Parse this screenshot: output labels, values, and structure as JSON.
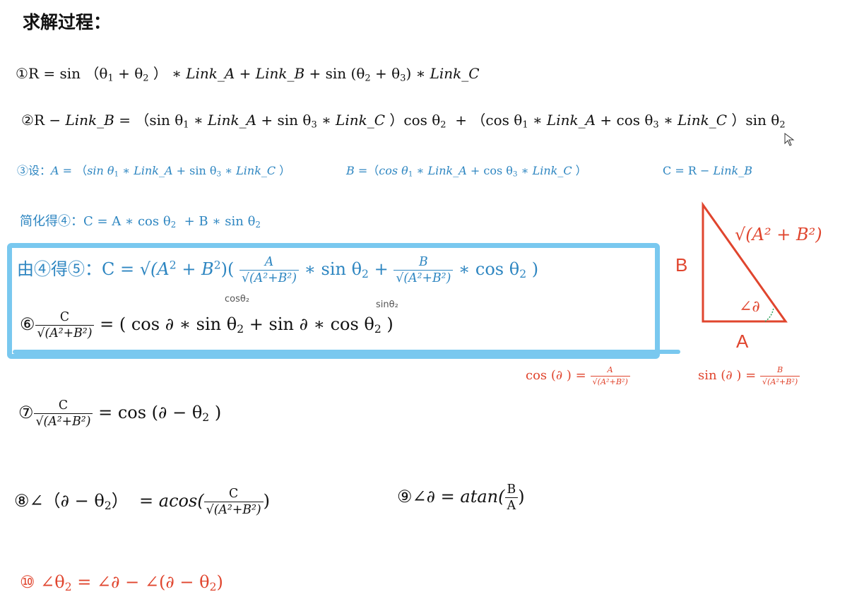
{
  "title": "求解过程：",
  "colors": {
    "blue": "#2e86c1",
    "red": "#e0452e",
    "highlight": "#79c8ef",
    "text": "#111111"
  },
  "eq1": {
    "marker": "①",
    "r": "R",
    "eq": "=",
    "sin": "sin",
    "lp": "（θ",
    "one": "1",
    "plus": "+ θ",
    "two": "2",
    "rp": "）",
    "mul": "∗",
    "linkA": "Link_A",
    "p1": "+",
    "linkB": "Link_B",
    "sin2": "+ sin (θ",
    "two2": "2",
    "plus2": "+ θ",
    "three": "3",
    "rp2": ")",
    "mul2": "∗",
    "linkC": "Link_C"
  },
  "eq2": {
    "marker": "②",
    "lhs": "R −",
    "linkB": "Link_B",
    "eq": "=",
    "p1": "（sin θ",
    "one": "1",
    "mul": "∗",
    "linkA": "Link_A",
    "sin3": "+ sin θ",
    "three": "3",
    "mul2": "∗",
    "linkC": "Link_C",
    "cos": "）cos θ",
    "two": "2",
    "plus": "+ （cos θ",
    "one2": "1",
    "mul3": "∗",
    "linkA2": "Link_A",
    "cos3": "+ cos θ",
    "three2": "3",
    "mul4": "∗",
    "linkC2": "Link_C",
    "sin": "）sin θ",
    "two2": "2"
  },
  "eq3": {
    "marker": "③设：",
    "a": "A",
    "eq": "=",
    "a_l": "（",
    "a_sin": "sin θ",
    "one": "1",
    "mul": "∗",
    "linkA": "Link_A",
    "a_sin3": "+ sin θ",
    "three": "3",
    "mul2": "∗",
    "linkC": "Link_C",
    "a_r": "）",
    "b": "B",
    "b_l": "=（",
    "b_cos": "cos θ",
    "one2": "1",
    "mul3": "∗",
    "linkA2": "Link_A",
    "b_cos3": "+ cos θ",
    "three2": "3",
    "mul4": "∗",
    "linkC2": "Link_C",
    "b_r": "）",
    "c": "C = R −",
    "linkB": "Link_B"
  },
  "eq4": {
    "prefix": "简化得④：C = A ∗ cos θ",
    "two": "2",
    "mid": "+ B ∗ sin θ",
    "two2": "2"
  },
  "eq5": {
    "prefix": "由④得⑤：C =",
    "sqrt": "√(A",
    "sq": "2",
    "plusb": "+ B",
    "sq2": "2",
    "rp": ")(",
    "fracA_num": "A",
    "fracA_den": "√(A²+B²)",
    "mul_sin": "∗ sin θ",
    "two": "2",
    "plus": "+",
    "fracB_num": "B",
    "fracB_den": "√(A²+B²)",
    "mul_cos": "∗ cos θ",
    "two2": "2",
    "end": ")"
  },
  "handnotes": {
    "cos": "cosθ₂",
    "sin": "sinθ₂"
  },
  "eq6": {
    "marker": "⑥",
    "num": "C",
    "den": "√(A²+B²)",
    "eq": "= (",
    "cos": "cos ∂ ∗ sin θ",
    "two": "2",
    "plus": "+",
    "sin": "sin ∂ ∗ cos θ",
    "two2": "2",
    "end": ")"
  },
  "eq7": {
    "marker": "⑦",
    "num": "C",
    "den": "√(A²+B²)",
    "rhs": "= cos (∂ − θ",
    "two": "2",
    "end": ")"
  },
  "eq8": {
    "marker": "⑧∠（∂ − θ",
    "two": "2",
    "mid": "）",
    "eq": "=",
    "acos": "acos(",
    "num": "C",
    "den": "√(A²+B²)",
    "end": ")"
  },
  "eq9": {
    "marker": "⑨∠∂ =",
    "atan": "atan(",
    "num": "B",
    "den": "A",
    "end": ")"
  },
  "eq10": {
    "marker": "⑩ ∠θ",
    "two": "2",
    "rhs": "= ∠∂ − ∠(∂ − θ",
    "two2": "2",
    "end": ")"
  },
  "triangle": {
    "hyp": "√(A² + B²)",
    "side_b": "B",
    "side_a": "A",
    "angle": "∠∂",
    "cos_def": "cos (∂ ) =",
    "cos_num": "A",
    "cos_den": "√(A²+B²)",
    "sin_def": "sin (∂ ) =",
    "sin_num": "B",
    "sin_den": "√(A²+B²)"
  }
}
